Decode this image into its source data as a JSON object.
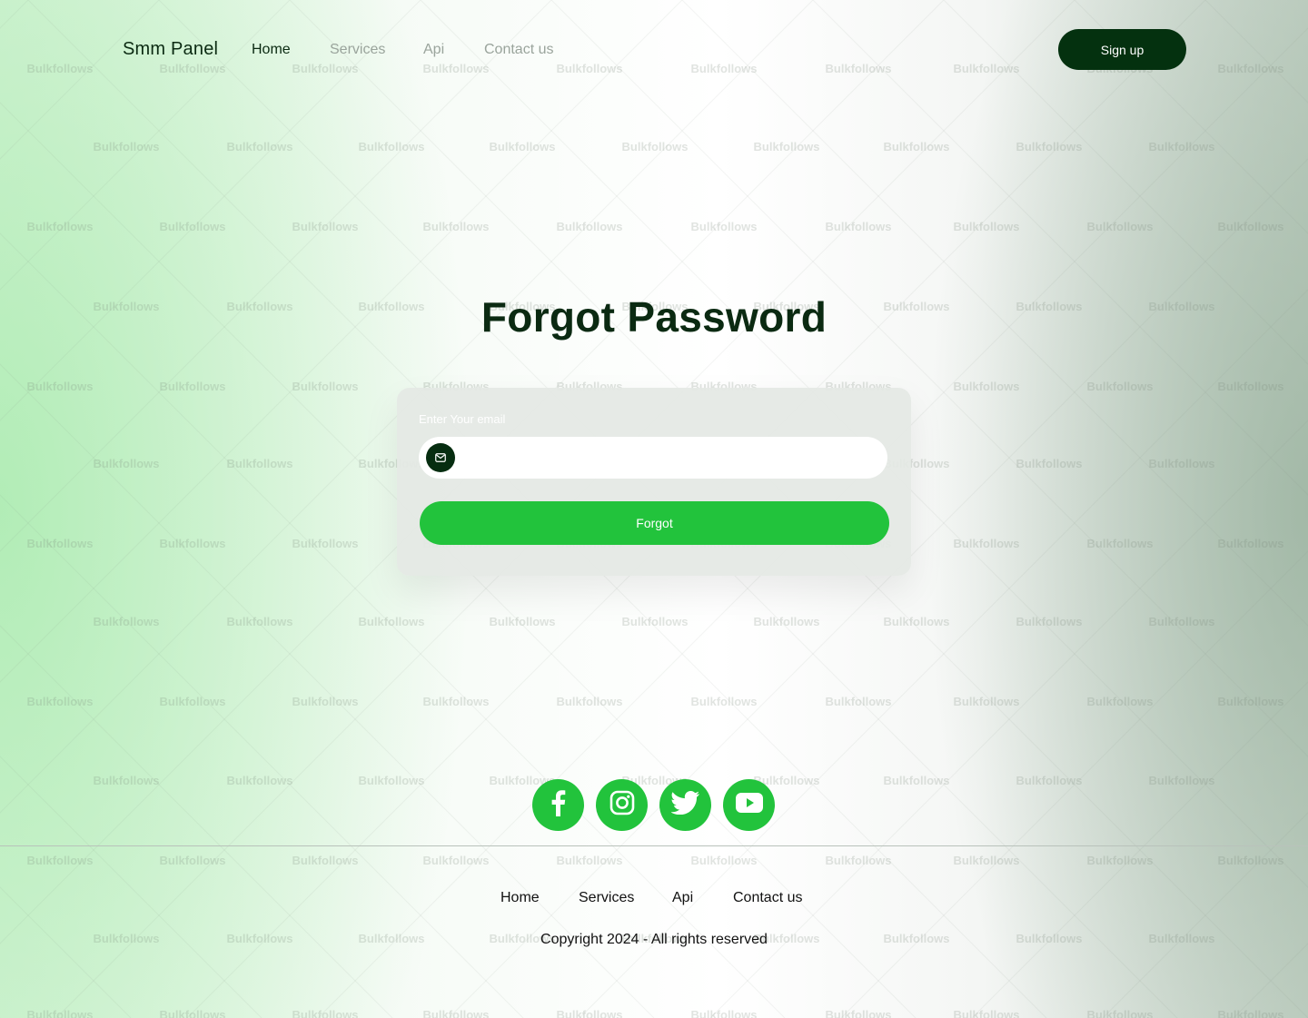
{
  "watermark": {
    "text": "Bulkfollows"
  },
  "header": {
    "brand": "Smm Panel",
    "nav": [
      "Home",
      "Services",
      "Api",
      "Contact us"
    ],
    "signup_label": "Sign up"
  },
  "main": {
    "title": "Forgot Password",
    "form": {
      "email_label": "Enter Your email",
      "email_value": "",
      "email_icon": "mail-icon",
      "submit_label": "Forgot"
    }
  },
  "footer": {
    "socials": [
      "facebook-icon",
      "instagram-icon",
      "twitter-icon",
      "youtube-icon"
    ],
    "links": [
      "Home",
      "Services",
      "Api",
      "Contact us"
    ],
    "copyright": "Copyright 2024 - All rights reserved"
  },
  "colors": {
    "accent_green": "#22c33c",
    "dark_green": "#04310f",
    "text_dark": "#0b2a12",
    "nav_muted": "#9aa49c"
  }
}
